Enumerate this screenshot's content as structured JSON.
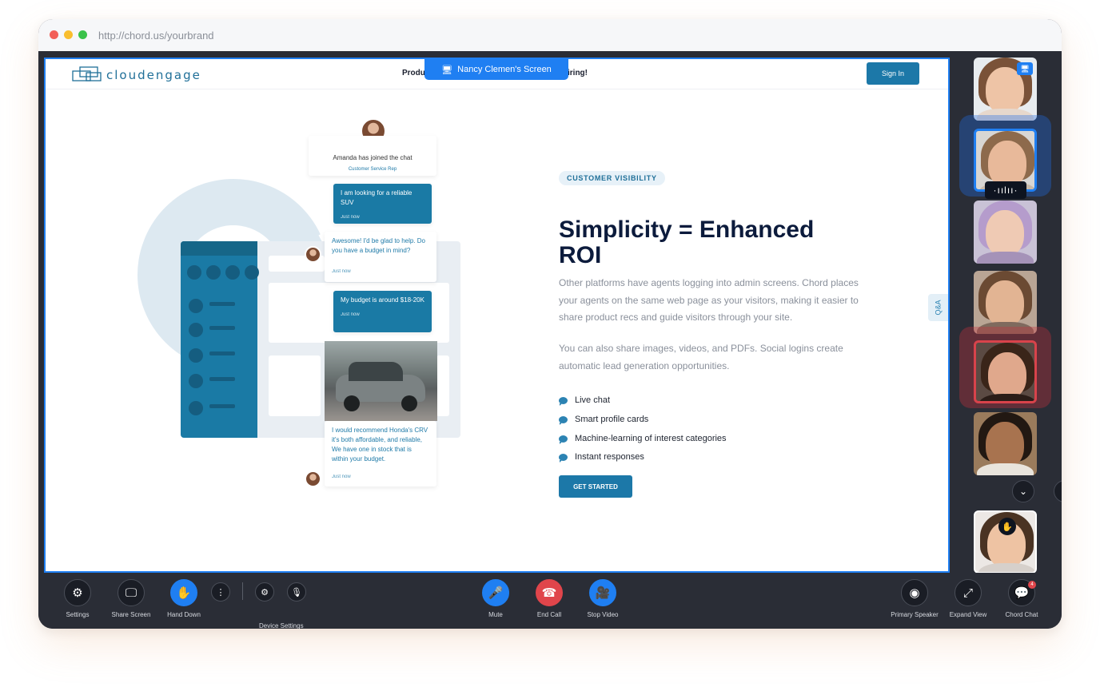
{
  "browser": {
    "url": "http://chord.us/yourbrand"
  },
  "shared_screen": {
    "presenter_label": "Nancy Clemen's Screen",
    "site": {
      "logo_text": "cloudengage",
      "nav_text_left": "Produ",
      "nav_text_right": "iring!",
      "sign_in_label": "Sign In",
      "badge": "CUSTOMER VISIBILITY",
      "title": "Simplicity = Enhanced ROI",
      "paragraph1": "Other platforms have agents logging into admin screens.  Chord places your agents on the same web page as your visitors, making it easier to share product recs and guide visitors through your site.",
      "paragraph2": "You can also share images, videos, and PDFs. Social logins create automatic lead generation opportunities.",
      "features": [
        "Live chat",
        "Smart profile cards",
        "Machine-learning of interest categories",
        "Instant responses"
      ],
      "cta_label": "GET STARTED",
      "qa_tab": "Q&A",
      "chat": {
        "joined_text": "Amanda has joined the chat",
        "joined_role": "Customer Service Rep",
        "messages": [
          {
            "text": "I am looking for a reliable SUV",
            "time": "Just now"
          },
          {
            "text": "Awesome! I'd be glad to help. Do you have a budget in mind?",
            "time": "Just now"
          },
          {
            "text": "My budget is around $18-20K",
            "time": "Just now"
          },
          {
            "text": "I would recommend Honda's CRV it's both affordable, and reliable, We have one in stock that is within your budget.",
            "time": "Just now"
          }
        ]
      }
    }
  },
  "participants": [
    {
      "name": "participant-1",
      "status": "sharing-screen",
      "icon": "screen-share-icon"
    },
    {
      "name": "participant-2",
      "status": "speaking",
      "icon": "voice-wave-icon",
      "voice_glyph": "·ıılıı·"
    },
    {
      "name": "participant-3",
      "status": "idle"
    },
    {
      "name": "participant-4",
      "status": "idle"
    },
    {
      "name": "participant-5",
      "status": "highlighted-red"
    },
    {
      "name": "participant-6",
      "status": "idle"
    },
    {
      "name": "self-view",
      "status": "hand-raised",
      "icon": "raised-hand-icon"
    }
  ],
  "toolbar": {
    "settings": "Settings",
    "share_screen": "Share Screen",
    "hand_down": "Hand Down",
    "device_settings": "Device Settings",
    "mute": "Mute",
    "end_call": "End Call",
    "stop_video": "Stop Video",
    "primary_speaker": "Primary Speaker",
    "expand_view": "Expand View",
    "chord_chat": "Chord Chat",
    "chat_badge": "4"
  },
  "colors": {
    "accent_blue": "#1f7ff2",
    "brand_teal": "#1c78a8",
    "end_call_red": "#e0454b",
    "toolbar_bg": "#2a2d36"
  }
}
